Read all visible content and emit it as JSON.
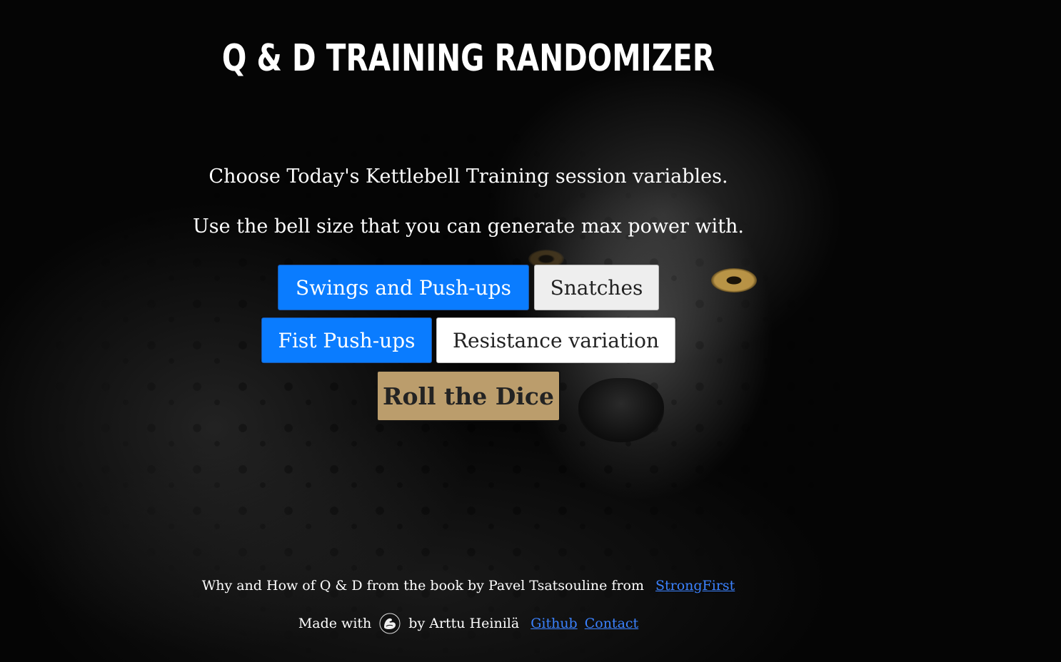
{
  "header": {
    "title": "Q & D TRAINING RANDOMIZER"
  },
  "intro": {
    "line1": "Choose Today's Kettlebell Training session variables.",
    "line2": "Use the bell size that you can generate max power with."
  },
  "options": {
    "swings": {
      "label": "Swings and Push-ups",
      "state": "selected"
    },
    "snatches": {
      "label": "Snatches",
      "state": "unselected"
    },
    "fist_pushups": {
      "label": "Fist Push-ups",
      "state": "selected"
    },
    "resistance": {
      "label": "Resistance variation",
      "state": "unselected"
    }
  },
  "roll": {
    "label": "Roll the Dice"
  },
  "footer": {
    "source_text": "Why and How of Q & D from the book by Pavel Tsatsouline from",
    "source_link": "StrongFirst",
    "made_with": "Made with",
    "made_icon": "flexed-bicep-icon",
    "by_text": "by Arttu Heinilä",
    "github_link": "Github",
    "contact_link": "Contact"
  },
  "colors": {
    "selected_button": "#0a7cff",
    "unselected_button": "#eeeeee",
    "roll_button": "#bb9d6c",
    "link": "#3b82ff"
  }
}
